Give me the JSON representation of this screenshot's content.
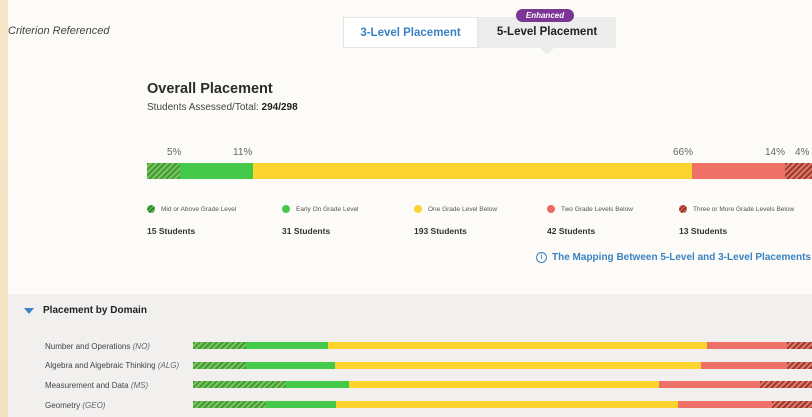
{
  "header": {
    "criterion_label": "Criterion Referenced",
    "tabs": [
      {
        "label": "3-Level Placement"
      },
      {
        "label": "5-Level Placement"
      }
    ],
    "enhanced_badge": "Enhanced"
  },
  "overall": {
    "title": "Overall Placement",
    "assessed_label": "Students Assessed/Total:",
    "assessed_value": "294/298",
    "percent_labels": [
      "5%",
      "11%",
      "66%",
      "14%",
      "4%"
    ],
    "segments_pct": [
      5,
      11,
      66,
      14,
      4
    ]
  },
  "legend": [
    {
      "label": "Mid or Above Grade Level",
      "count": "15 Students",
      "color": "#3e9a3a"
    },
    {
      "label": "Early On Grade Level",
      "count": "31 Students",
      "color": "#45c94a"
    },
    {
      "label": "One Grade Level Below",
      "count": "193 Students",
      "color": "#fcd42e"
    },
    {
      "label": "Two Grade Levels Below",
      "count": "42 Students",
      "color": "#ee7066"
    },
    {
      "label": "Three or More Grade Levels Below",
      "count": "13 Students",
      "color": "#9a3a2e"
    }
  ],
  "mapping_link": "The Mapping Between 5-Level and 3-Level Placements",
  "domains": {
    "title": "Placement by Domain",
    "rows": [
      {
        "name": "Number and Operations",
        "abbr": "(NO)",
        "segments_pct": [
          8.5,
          13.3,
          61.3,
          12.9,
          4.0
        ]
      },
      {
        "name": "Algebra and Algebraic Thinking",
        "abbr": "(ALG)",
        "segments_pct": [
          8.5,
          14.4,
          59.2,
          13.9,
          4.0
        ]
      },
      {
        "name": "Measurement and Data",
        "abbr": "(MS)",
        "segments_pct": [
          15.0,
          10.2,
          50.1,
          16.3,
          8.4
        ]
      },
      {
        "name": "Geometry",
        "abbr": "(GEO)",
        "segments_pct": [
          11.8,
          11.3,
          55.3,
          15.2,
          6.4
        ]
      }
    ]
  }
}
